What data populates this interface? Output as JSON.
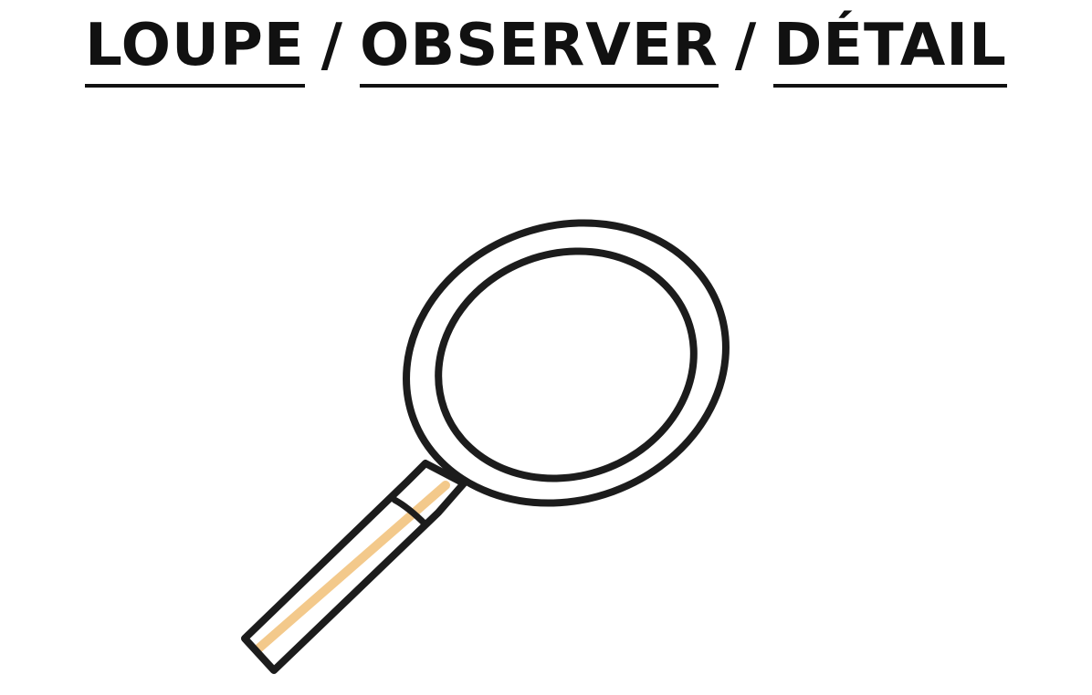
{
  "title": {
    "word1": "LOUPE",
    "sep1": "/",
    "word2": "OBSERVER",
    "sep2": "/",
    "word3": "DÉTAIL"
  },
  "icon": {
    "name": "magnifying-glass-icon"
  },
  "colors": {
    "ink": "#1c1c1c",
    "highlight": "#f3c98b",
    "background": "#ffffff"
  }
}
